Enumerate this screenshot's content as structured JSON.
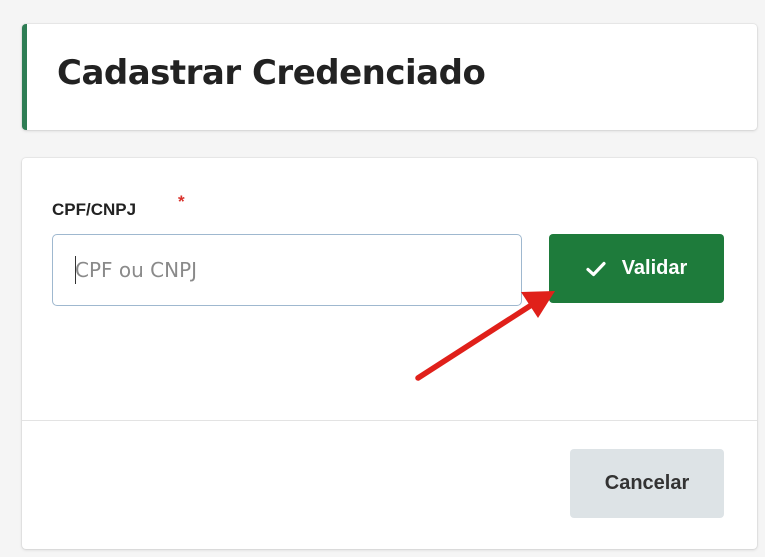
{
  "header": {
    "title": "Cadastrar Credenciado"
  },
  "form": {
    "cpf_label": "CPF/CNPJ",
    "required_marker": "*",
    "cpf_input": {
      "value": "",
      "placeholder": "CPF ou CNPJ"
    },
    "validate_label": "Validar",
    "validate_icon": "check-icon",
    "cancel_label": "Cancelar"
  },
  "colors": {
    "accent_green": "#1e7b3b",
    "header_border": "#2e7d54",
    "required_red": "#d9302a",
    "arrow_red": "#e0201a",
    "cancel_bg": "#dde3e6"
  }
}
